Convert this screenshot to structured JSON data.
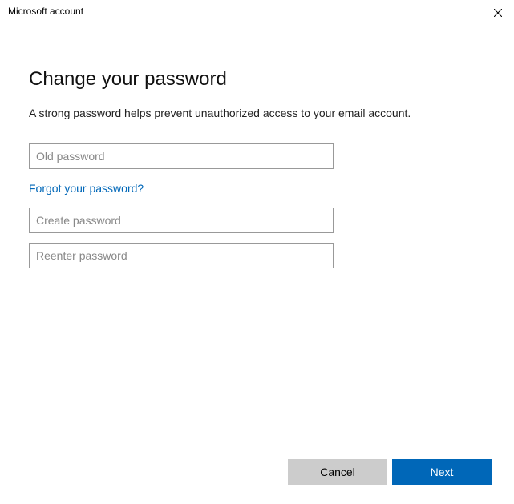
{
  "window": {
    "title": "Microsoft account"
  },
  "page": {
    "heading": "Change your password",
    "subtext": "A strong password helps prevent unauthorized access to your email account."
  },
  "fields": {
    "old_password_placeholder": "Old password",
    "forgot_link": "Forgot your password?",
    "create_password_placeholder": "Create password",
    "reenter_password_placeholder": "Reenter password"
  },
  "buttons": {
    "cancel": "Cancel",
    "next": "Next"
  }
}
